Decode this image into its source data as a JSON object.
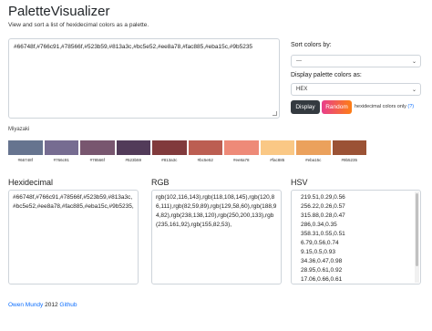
{
  "app": {
    "title": "PaletteVisualizer",
    "subtitle": "View and sort a list of hexidecimal colors as a palette."
  },
  "input": {
    "value": "#66748f,#766c91,#78566f,#523b59,#813a3c,#bc5e52,#ee8a78,#fac885,#eba15c,#9b5235"
  },
  "sort": {
    "label": "Sort colors by:",
    "value": "---"
  },
  "display_as": {
    "label": "Display palette colors as:",
    "value": "HEX"
  },
  "buttons": {
    "display": "Display",
    "random": "Random"
  },
  "hex_note": {
    "text": "hexidecimal colors only",
    "help": "(?)"
  },
  "palette": {
    "name": "Miyazaki",
    "swatches": [
      {
        "label": "#66748f",
        "color": "#66748f"
      },
      {
        "label": "#766c91",
        "color": "#766c91"
      },
      {
        "label": "#78566f",
        "color": "#78566f"
      },
      {
        "label": "#523b59",
        "color": "#523b59"
      },
      {
        "label": "#813a3c",
        "color": "#813a3c"
      },
      {
        "label": "#bc5e52",
        "color": "#bc5e52"
      },
      {
        "label": "#ee8a78",
        "color": "#ee8a78"
      },
      {
        "label": "#fac885",
        "color": "#fac885"
      },
      {
        "label": "#eba15c",
        "color": "#eba15c"
      },
      {
        "label": "#9b5235",
        "color": "#9b5235"
      }
    ]
  },
  "columns": {
    "hex": {
      "title": "Hexidecimal",
      "text": "#66748f,#766c91,#78566f,#523b59,#813a3c,#bc5e52,#ee8a78,#fac885,#eba15c,#9b5235,"
    },
    "rgb": {
      "title": "RGB",
      "text": "rgb(102,116,143),rgb(118,108,145),rgb(120,86,111),rgb(82,59,89),rgb(129,58,60),rgb(188,94,82),rgb(238,138,120),rgb(250,200,133),rgb(235,161,92),rgb(155,82,53),"
    },
    "hsv": {
      "title": "HSV",
      "lines": [
        "219.51,0.29,0.56",
        "256.22,0.26,0.57",
        "315.88,0.28,0.47",
        "286,0.34,0.35",
        "358.31,0.55,0.51",
        "6.79,0.56,0.74",
        "9.15,0.5,0.93",
        "34.36,0.47,0.98",
        "28.95,0.61,0.92",
        "17.06,0.66,0.61"
      ]
    }
  },
  "footer": {
    "author": "Owen Mundy",
    "year": "2012",
    "repo": "Github"
  }
}
